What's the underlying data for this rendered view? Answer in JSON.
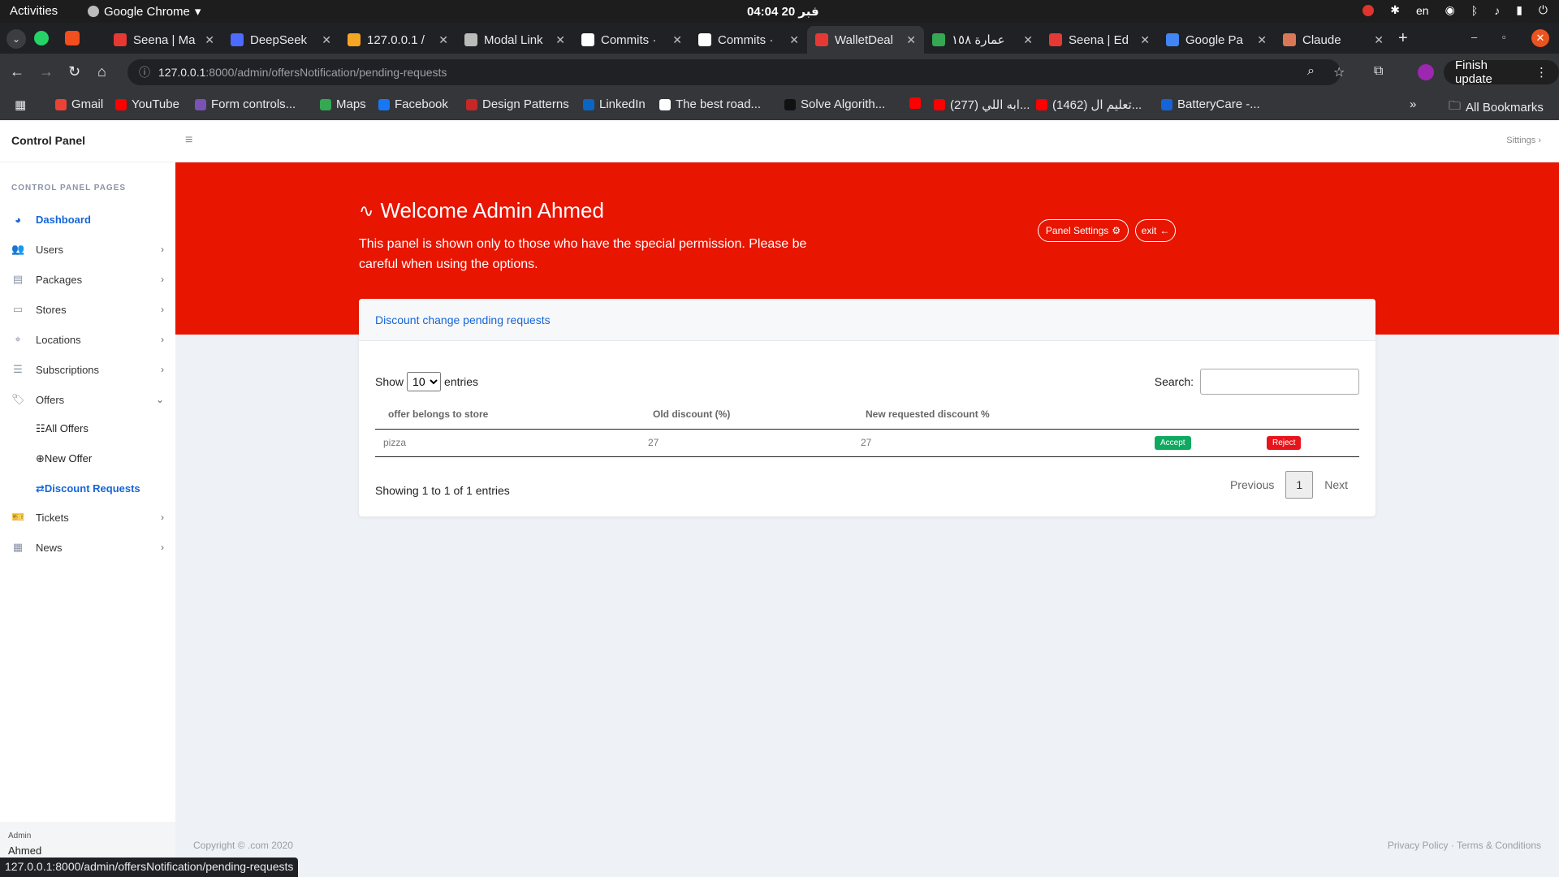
{
  "os": {
    "activities": "Activities",
    "app_name": "Google Chrome",
    "clock": "04:04 فبر 20",
    "lang": "en"
  },
  "tabs": [
    {
      "title": "Seena | Ma",
      "color": "#e53935"
    },
    {
      "title": "DeepSeek",
      "color": "#4d6bfe"
    },
    {
      "title": "127.0.0.1 /",
      "color": "#f5a623"
    },
    {
      "title": "Modal Link",
      "color": "#bbbbbb"
    },
    {
      "title": "Commits ·",
      "color": "#ffffff"
    },
    {
      "title": "Commits ·",
      "color": "#ffffff"
    },
    {
      "title": "WalletDeal",
      "color": "#e53935"
    },
    {
      "title": "عمارة ١٥٨",
      "color": "#34a853"
    },
    {
      "title": "Seena | Ed",
      "color": "#e53935"
    },
    {
      "title": "Google Pa",
      "color": "#4285f4"
    },
    {
      "title": "Claude",
      "color": "#d97757"
    }
  ],
  "address": {
    "host": "127.0.0.1",
    "path": ":8000/admin/offersNotification/pending-requests"
  },
  "finish_update": "Finish update",
  "bookmarks": [
    {
      "label": "Gmail",
      "color": "#ea4335"
    },
    {
      "label": "YouTube",
      "color": "#ff0000"
    },
    {
      "label": "Form controls...",
      "color": "#7952b3"
    },
    {
      "label": "Maps",
      "color": "#34a853"
    },
    {
      "label": "Facebook",
      "color": "#1877f2"
    },
    {
      "label": "Design Patterns",
      "color": "#c62828"
    },
    {
      "label": "LinkedIn",
      "color": "#0a66c2"
    },
    {
      "label": "The best road...",
      "color": "#ffffff"
    },
    {
      "label": "Solve Algorith...",
      "color": "#111111"
    },
    {
      "label": "",
      "color": "#ff0000"
    },
    {
      "label": "(277) ابه اللي...",
      "color": "#ff0000"
    },
    {
      "label": "(1462) تعليم ال...",
      "color": "#ff0000"
    },
    {
      "label": "BatteryCare -...",
      "color": "#1565d8"
    }
  ],
  "all_bookmarks": "All Bookmarks",
  "app": {
    "brand": "Control Panel",
    "settings_link": "Sittings",
    "sidebar": {
      "heading": "CONTROL PANEL PAGES",
      "items": [
        {
          "label": "Dashboard"
        },
        {
          "label": "Users"
        },
        {
          "label": "Packages"
        },
        {
          "label": "Stores"
        },
        {
          "label": "Locations"
        },
        {
          "label": "Subscriptions"
        },
        {
          "label": "Offers"
        },
        {
          "label": "Tickets"
        },
        {
          "label": "News"
        }
      ],
      "offers_sub": [
        {
          "label": "All Offers"
        },
        {
          "label": "New Offer"
        },
        {
          "label": "Discount Requests"
        }
      ],
      "footer_role": "Admin",
      "footer_name": "Ahmed"
    },
    "hero": {
      "title": "Welcome Admin Ahmed",
      "subtitle": "This panel is shown only to those who have the special permission. Please be careful when using the options.",
      "panel_settings": "Panel Settings",
      "exit": "exit"
    },
    "card": {
      "title": "Discount change pending requests",
      "show_label": "Show",
      "entries_label": "entries",
      "page_size": "10",
      "search_label": "Search:",
      "columns": [
        "offer belongs to store",
        "Old discount (%)",
        "New requested discount %",
        "",
        ""
      ],
      "rows": [
        {
          "store": "pizza",
          "old": "27",
          "new": "27",
          "accept": "Accept",
          "reject": "Reject"
        }
      ],
      "info": "Showing 1 to 1 of 1 entries",
      "prev": "Previous",
      "page": "1",
      "next": "Next"
    },
    "copyright": "Copyright © .com 2020",
    "footer_links": "Privacy Policy · Terms & Conditions"
  },
  "status_url": "127.0.0.1:8000/admin/offersNotification/pending-requests",
  "colors": {
    "accent": "#1565d8",
    "hero_red": "#e81500",
    "accept": "#0fa960",
    "reject": "#e8141c"
  }
}
